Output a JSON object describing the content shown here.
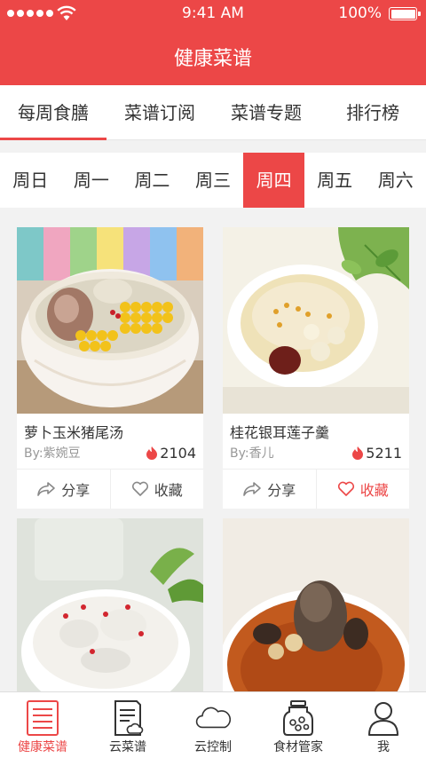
{
  "status": {
    "time": "9:41 AM",
    "battery": "100%",
    "battery_level": 1.0
  },
  "nav": {
    "title": "健康菜谱"
  },
  "tabs": [
    {
      "label": "每周食膳"
    },
    {
      "label": "菜谱订阅"
    },
    {
      "label": "菜谱专题"
    },
    {
      "label": "排行榜"
    }
  ],
  "active_tab": 0,
  "days": [
    "周日",
    "周一",
    "周二",
    "周三",
    "周四",
    "周五",
    "周六"
  ],
  "active_day": 4,
  "recipes": [
    {
      "title": "萝卜玉米猪尾汤",
      "author": "By:紫婉豆",
      "views": "2104",
      "share": "分享",
      "fav": "收藏",
      "favorited": false
    },
    {
      "title": "桂花银耳莲子羹",
      "author": "By:香儿",
      "views": "5211",
      "share": "分享",
      "fav": "收藏",
      "favorited": true
    },
    {
      "title": "",
      "author": "",
      "views": ""
    },
    {
      "title": "",
      "author": "",
      "views": ""
    }
  ],
  "bottom_nav": [
    {
      "label": "健康菜谱",
      "icon": "recipe-book-icon"
    },
    {
      "label": "云菜谱",
      "icon": "cloud-recipe-icon"
    },
    {
      "label": "云控制",
      "icon": "cloud-icon"
    },
    {
      "label": "食材管家",
      "icon": "jar-icon"
    },
    {
      "label": "我",
      "icon": "user-icon"
    }
  ],
  "colors": {
    "accent": "#ec4747",
    "background": "#f2f2f2"
  }
}
